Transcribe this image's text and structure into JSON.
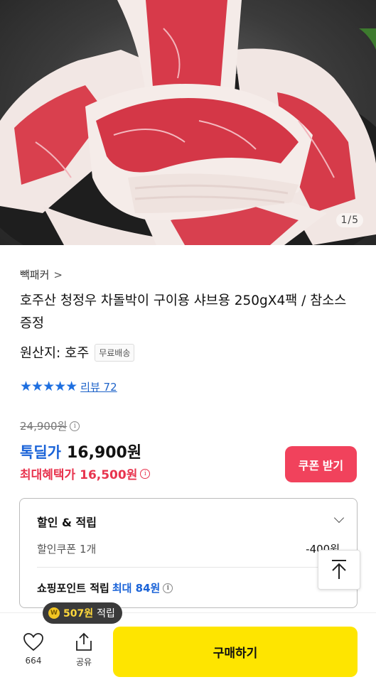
{
  "gallery": {
    "counter": "1/5"
  },
  "product": {
    "brand": "빽패커",
    "brand_chevron": ">",
    "title": "호주산 청정우 차돌박이 구이용 샤브용 250gX4팩 / 참소스 증정",
    "origin": "원산지: 호주",
    "shipping_badge": "무료배송"
  },
  "rating": {
    "stars": "★★★★★",
    "review_label": "리뷰 72"
  },
  "price": {
    "original": "24,900원",
    "sale_label": "톡딜가",
    "sale_price": "16,900원",
    "max_benefit": "최대혜택가 16,500원",
    "info_glyph": "i"
  },
  "coupon_button": "쿠폰 받기",
  "discount_box": {
    "title": "할인 & 적립",
    "coupon_label": "할인쿠폰 1개",
    "coupon_value": "-400원",
    "point_label": "쇼핑포인트 적립",
    "point_max": "최대 84원"
  },
  "bottom_bar": {
    "point_pill": {
      "coin": "W",
      "amount": "507원",
      "label": "적립"
    },
    "like_count": "664",
    "share_label": "공유",
    "buy_label": "구매하기"
  },
  "colors": {
    "accent_blue": "#1a63d8",
    "accent_red": "#f1425c",
    "buy_yellow": "#fee500"
  }
}
